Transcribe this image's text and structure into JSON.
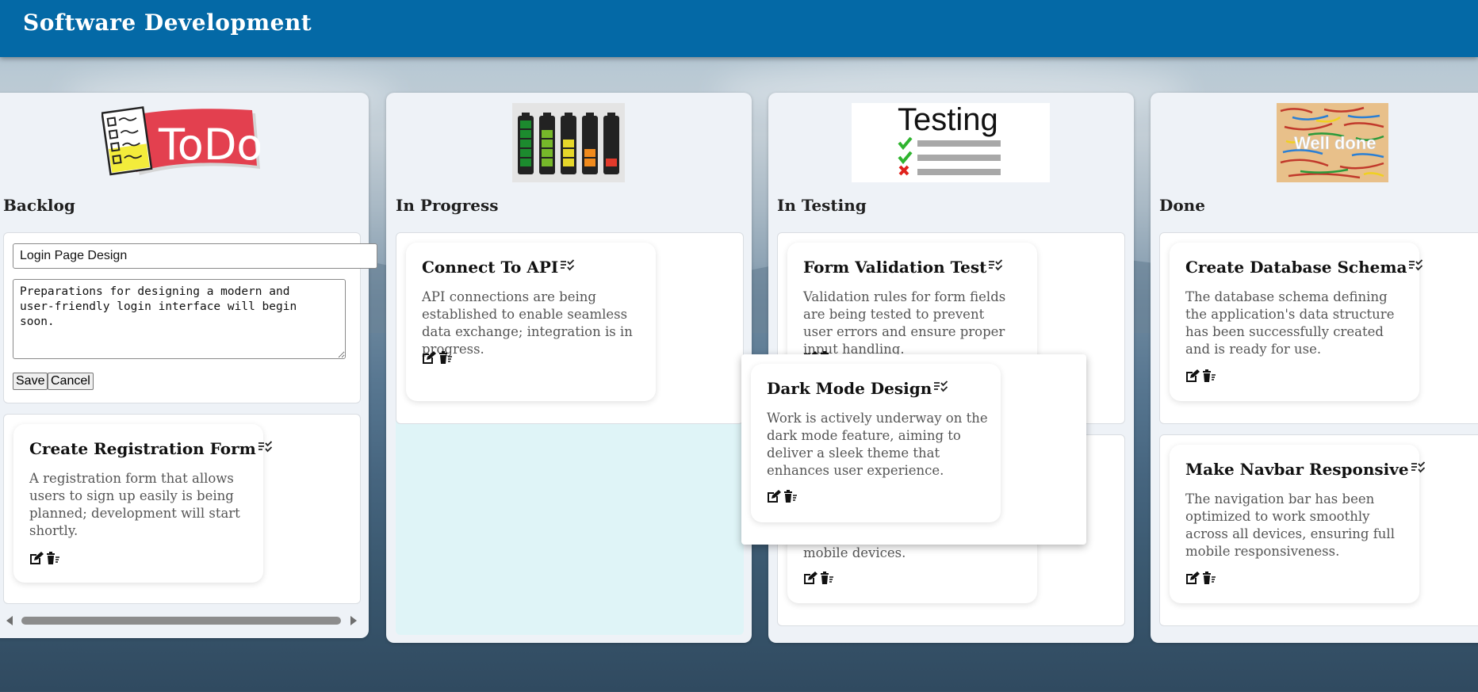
{
  "header": {
    "title": "Software Development"
  },
  "columns": {
    "backlog": {
      "title": "Backlog"
    },
    "in_progress": {
      "title": "In Progress"
    },
    "in_testing": {
      "title": "In Testing"
    },
    "done": {
      "title": "Done"
    }
  },
  "images": {
    "todo_text": "ToDo",
    "testing_text": "Testing",
    "done_text": "Well done"
  },
  "editor": {
    "title_value": "Login Page Design",
    "description_value": "Preparations for designing a modern and\nuser-friendly login interface will begin\nsoon.",
    "save_label": "Save",
    "cancel_label": "Cancel"
  },
  "cards": {
    "registration": {
      "title": "Create Registration Form",
      "desc": "A registration form that allows users to sign up easily is being planned; development will start shortly."
    },
    "api": {
      "title": "Connect To API",
      "desc": "API connections are being established to enable seamless data exchange; integration is in progress."
    },
    "form_validation": {
      "title": "Form Validation Test",
      "desc": "Validation rules for form fields are being tested to prevent user errors and ensure proper input handling."
    },
    "mobile_partial": {
      "desc": "mobile devices."
    },
    "dark_mode": {
      "title": "Dark Mode Design",
      "desc": "Work is actively underway on the dark mode feature, aiming to deliver a sleek theme that enhances user experience."
    },
    "db_schema": {
      "title": "Create Database Schema",
      "desc": "The database schema defining the application's data structure has been successfully created and is ready for use."
    },
    "navbar": {
      "title": "Make Navbar Responsive",
      "desc": "The navigation bar has been optimized to work smoothly across all devices, ensuring full mobile responsiveness."
    }
  },
  "icons": {
    "title_icon": "checklist-icon",
    "edit_icon": "edit-icon",
    "delete_icon": "trash-icon"
  },
  "colors": {
    "header": "#0469a6",
    "column_bg": "#eef2f7",
    "drop_highlight": "#dff4f7"
  }
}
